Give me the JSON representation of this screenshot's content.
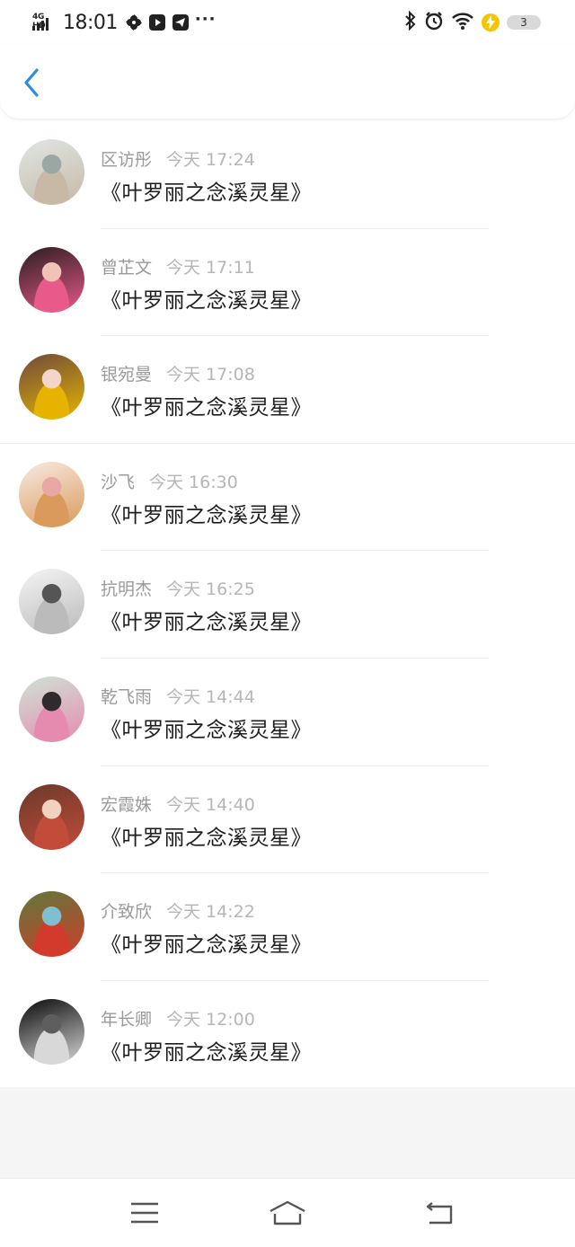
{
  "status_bar": {
    "network": "4G HD",
    "time": "18:01",
    "battery": "3"
  },
  "header": {
    "back_icon": "chevron-left-icon"
  },
  "comments": [
    {
      "name": "区访彤",
      "time": "今天 17:24",
      "text": "《叶罗丽之念溪灵星》",
      "avatar_colors": [
        "#dfe6e4",
        "#9aa7a3",
        "#c7b9a6"
      ]
    },
    {
      "name": "曾芷文",
      "time": "今天 17:11",
      "text": "《叶罗丽之念溪灵星》",
      "avatar_colors": [
        "#2b1d1f",
        "#f1c3b8",
        "#e85a8a"
      ]
    },
    {
      "name": "银宛曼",
      "time": "今天 17:08",
      "text": "《叶罗丽之念溪灵星》",
      "avatar_colors": [
        "#6e4a3c",
        "#f3d6c9",
        "#e6b400"
      ]
    },
    {
      "name": "沙飞",
      "time": "今天 16:30",
      "text": "《叶罗丽之念溪灵星》",
      "avatar_colors": [
        "#f8ebe3",
        "#e8a7a2",
        "#d99a5b"
      ]
    },
    {
      "name": "抗明杰",
      "time": "今天 16:25",
      "text": "《叶罗丽之念溪灵星》",
      "avatar_colors": [
        "#f4f4f4",
        "#555555",
        "#bbbbbb"
      ]
    },
    {
      "name": "乾飞雨",
      "time": "今天 14:44",
      "text": "《叶罗丽之念溪灵星》",
      "avatar_colors": [
        "#cfe3d6",
        "#2f2a2e",
        "#e58bb0"
      ]
    },
    {
      "name": "宏霞姝",
      "time": "今天 14:40",
      "text": "《叶罗丽之念溪灵星》",
      "avatar_colors": [
        "#6b3a2a",
        "#f1d2bf",
        "#c24b3a"
      ]
    },
    {
      "name": "介致欣",
      "time": "今天 14:22",
      "text": "《叶罗丽之念溪灵星》",
      "avatar_colors": [
        "#5d7a3a",
        "#7fbfd0",
        "#d23b2b"
      ]
    },
    {
      "name": "年长卿",
      "time": "今天 12:00",
      "text": "《叶罗丽之念溪灵星》",
      "avatar_colors": [
        "#0a0a0a",
        "#5e5e5e",
        "#d8d8d8"
      ]
    }
  ],
  "nav_bar": {
    "icons": [
      "menu-icon",
      "home-icon",
      "back-icon"
    ]
  }
}
